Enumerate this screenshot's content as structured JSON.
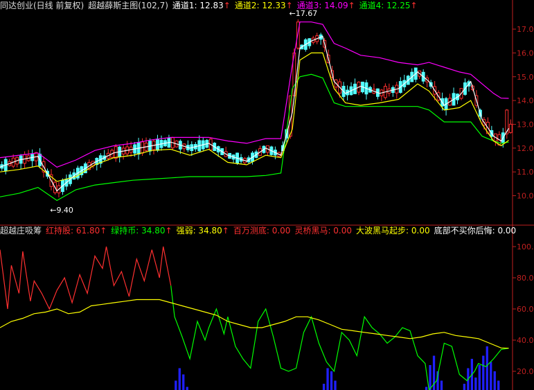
{
  "top_header": {
    "title": "同达创业(日线 前复权)",
    "indicator": "超越薛斯主图(102,7)",
    "items": [
      {
        "label": "通道1: 12.83",
        "arrow": "↑",
        "color": "#ffffff"
      },
      {
        "label": "通道2: 12.33",
        "arrow": "↑",
        "color": "#ffff00"
      },
      {
        "label": "通道3: 14.09",
        "arrow": "↑",
        "color": "#ff00ff"
      },
      {
        "label": "通道4: 12.25",
        "arrow": "↑",
        "color": "#00ff00"
      }
    ]
  },
  "bottom_header": {
    "title": "超越庄吸筹",
    "items": [
      {
        "label": "红持股: 61.80",
        "arrow": "↑",
        "color": "#ff3030"
      },
      {
        "label": "绿持币: 34.80",
        "arrow": "↑",
        "color": "#00ff00"
      },
      {
        "label": "强弱: 34.80",
        "arrow": "↑",
        "color": "#ffff00"
      },
      {
        "label": "百万测底: 0.00",
        "arrow": "",
        "color": "#ff3030"
      },
      {
        "label": "灵桥黑马: 0.00",
        "arrow": "",
        "color": "#ff3030"
      },
      {
        "label": "大波黑马起步: 0.00",
        "arrow": "",
        "color": "#ffff00"
      },
      {
        "label": "底部不买你后悔: 0.00",
        "arrow": "",
        "color": "#ffffff"
      }
    ]
  },
  "colors": {
    "up": "#ff3030",
    "down": "#54ffff",
    "ch1": "#ffffff",
    "ch2": "#ffff00",
    "ch3": "#ff00ff",
    "ch4": "#00ff00",
    "blue": "#2020ff",
    "axis": "#c02020"
  },
  "chart_data": [
    {
      "type": "candlestick",
      "annotations": [
        {
          "text": "9.40",
          "x": 15,
          "y": 9.4,
          "prefix": "←"
        },
        {
          "text": "17.67",
          "x": 78,
          "y": 17.67,
          "prefix": "←"
        }
      ],
      "xlim": [
        0,
        135
      ],
      "ylim": [
        9.2,
        17.7
      ],
      "yticks": [
        "10.0",
        "11.0",
        "12.0",
        "13.0",
        "14.0",
        "15.0",
        "16.0",
        "17.0"
      ],
      "channel1": [
        [
          0,
          11.2
        ],
        [
          5,
          11.5
        ],
        [
          10,
          11.65
        ],
        [
          15,
          10.2
        ],
        [
          20,
          10.9
        ],
        [
          25,
          11.4
        ],
        [
          30,
          11.8
        ],
        [
          35,
          11.95
        ],
        [
          40,
          12.1
        ],
        [
          45,
          12.25
        ],
        [
          50,
          12.0
        ],
        [
          55,
          12.2
        ],
        [
          60,
          11.7
        ],
        [
          65,
          11.45
        ],
        [
          70,
          12.0
        ],
        [
          74,
          11.7
        ],
        [
          77,
          13.5
        ],
        [
          79,
          16.2
        ],
        [
          82,
          16.5
        ],
        [
          85,
          16.7
        ],
        [
          88,
          14.8
        ],
        [
          91,
          14.3
        ],
        [
          95,
          14.6
        ],
        [
          100,
          14.3
        ],
        [
          105,
          14.5
        ],
        [
          110,
          15.2
        ],
        [
          113,
          14.8
        ],
        [
          117,
          13.8
        ],
        [
          121,
          14.2
        ],
        [
          124,
          14.8
        ],
        [
          127,
          13.2
        ],
        [
          130,
          12.5
        ],
        [
          132,
          12.3
        ],
        [
          134,
          12.83
        ]
      ],
      "channel2": [
        [
          0,
          11.0
        ],
        [
          5,
          11.1
        ],
        [
          10,
          11.25
        ],
        [
          15,
          10.6
        ],
        [
          20,
          10.8
        ],
        [
          25,
          11.3
        ],
        [
          30,
          11.6
        ],
        [
          35,
          11.7
        ],
        [
          40,
          11.9
        ],
        [
          45,
          11.95
        ],
        [
          50,
          11.7
        ],
        [
          55,
          11.95
        ],
        [
          60,
          11.4
        ],
        [
          65,
          11.3
        ],
        [
          70,
          11.7
        ],
        [
          74,
          11.6
        ],
        [
          77,
          12.8
        ],
        [
          79,
          15.7
        ],
        [
          82,
          16.0
        ],
        [
          85,
          16.0
        ],
        [
          88,
          14.5
        ],
        [
          91,
          13.9
        ],
        [
          95,
          13.8
        ],
        [
          100,
          13.9
        ],
        [
          105,
          14.05
        ],
        [
          110,
          14.7
        ],
        [
          113,
          14.4
        ],
        [
          117,
          13.6
        ],
        [
          121,
          13.7
        ],
        [
          124,
          14.0
        ],
        [
          127,
          13.0
        ],
        [
          130,
          12.3
        ],
        [
          132,
          12.1
        ],
        [
          134,
          12.33
        ]
      ],
      "channel3": [
        [
          0,
          11.6
        ],
        [
          5,
          11.7
        ],
        [
          10,
          11.8
        ],
        [
          15,
          11.2
        ],
        [
          20,
          11.5
        ],
        [
          25,
          11.9
        ],
        [
          30,
          12.1
        ],
        [
          35,
          12.2
        ],
        [
          40,
          12.35
        ],
        [
          45,
          12.45
        ],
        [
          50,
          12.45
        ],
        [
          55,
          12.45
        ],
        [
          60,
          12.3
        ],
        [
          65,
          12.2
        ],
        [
          70,
          12.4
        ],
        [
          74,
          12.4
        ],
        [
          77,
          15.5
        ],
        [
          79,
          17.3
        ],
        [
          82,
          17.3
        ],
        [
          85,
          17.2
        ],
        [
          88,
          16.4
        ],
        [
          91,
          16.2
        ],
        [
          95,
          15.9
        ],
        [
          100,
          15.8
        ],
        [
          105,
          15.6
        ],
        [
          110,
          15.5
        ],
        [
          113,
          15.6
        ],
        [
          117,
          15.4
        ],
        [
          121,
          15.2
        ],
        [
          124,
          15.1
        ],
        [
          127,
          14.7
        ],
        [
          130,
          14.3
        ],
        [
          132,
          14.1
        ],
        [
          134,
          14.09
        ]
      ],
      "channel4": [
        [
          0,
          9.95
        ],
        [
          5,
          10.1
        ],
        [
          10,
          10.35
        ],
        [
          15,
          9.8
        ],
        [
          20,
          10.25
        ],
        [
          25,
          10.45
        ],
        [
          30,
          10.55
        ],
        [
          35,
          10.65
        ],
        [
          40,
          10.7
        ],
        [
          45,
          10.75
        ],
        [
          50,
          10.8
        ],
        [
          55,
          10.8
        ],
        [
          60,
          10.8
        ],
        [
          65,
          10.8
        ],
        [
          70,
          10.85
        ],
        [
          74,
          10.95
        ],
        [
          77,
          14.5
        ],
        [
          79,
          15.0
        ],
        [
          82,
          15.1
        ],
        [
          85,
          14.95
        ],
        [
          88,
          13.9
        ],
        [
          91,
          13.75
        ],
        [
          95,
          13.75
        ],
        [
          100,
          13.75
        ],
        [
          105,
          13.75
        ],
        [
          110,
          13.75
        ],
        [
          113,
          13.6
        ],
        [
          117,
          13.1
        ],
        [
          121,
          13.1
        ],
        [
          124,
          13.1
        ],
        [
          127,
          12.5
        ],
        [
          130,
          12.3
        ],
        [
          132,
          12.2
        ],
        [
          134,
          12.25
        ]
      ]
    },
    {
      "type": "line",
      "xlim": [
        0,
        135
      ],
      "ylim": [
        8,
        108
      ],
      "yticks": [
        "20.0",
        "40.0",
        "60.0",
        "80.0",
        "100.0"
      ],
      "series": [
        {
          "name": "红持股",
          "points": [
            [
              0,
              98
            ],
            [
              2,
              60
            ],
            [
              3,
              88
            ],
            [
              5,
              70
            ],
            [
              6,
              97
            ],
            [
              8,
              65
            ],
            [
              9,
              78
            ],
            [
              11,
              70
            ],
            [
              13,
              60
            ],
            [
              15,
              72
            ],
            [
              17,
              80
            ],
            [
              19,
              64
            ],
            [
              21,
              82
            ],
            [
              23,
              70
            ],
            [
              25,
              94
            ],
            [
              27,
              86
            ],
            [
              28,
              100
            ],
            [
              30,
              75
            ],
            [
              32,
              84
            ],
            [
              34,
              68
            ],
            [
              36,
              92
            ],
            [
              38,
              78
            ],
            [
              40,
              98
            ],
            [
              42,
              80
            ],
            [
              43,
              100
            ],
            [
              45,
              75
            ]
          ]
        },
        {
          "name": "绿持币",
          "points": [
            [
              45,
              75
            ],
            [
              46,
              55
            ],
            [
              48,
              42
            ],
            [
              50,
              28
            ],
            [
              52,
              52
            ],
            [
              54,
              40
            ],
            [
              55,
              48
            ],
            [
              57,
              60
            ],
            [
              59,
              44
            ],
            [
              60,
              55
            ],
            [
              62,
              36
            ],
            [
              64,
              28
            ],
            [
              66,
              22
            ],
            [
              68,
              52
            ],
            [
              70,
              60
            ],
            [
              72,
              42
            ],
            [
              74,
              22
            ],
            [
              76,
              20
            ],
            [
              78,
              22
            ],
            [
              80,
              45
            ],
            [
              82,
              55
            ],
            [
              84,
              38
            ],
            [
              86,
              26
            ],
            [
              88,
              20
            ],
            [
              90,
              45
            ],
            [
              92,
              40
            ],
            [
              94,
              30
            ],
            [
              96,
              55
            ],
            [
              98,
              48
            ],
            [
              100,
              44
            ],
            [
              102,
              38
            ],
            [
              104,
              42
            ],
            [
              106,
              48
            ],
            [
              108,
              46
            ],
            [
              110,
              30
            ],
            [
              112,
              25
            ],
            [
              113,
              8
            ],
            [
              115,
              14
            ],
            [
              117,
              38
            ],
            [
              119,
              36
            ],
            [
              121,
              18
            ],
            [
              123,
              14
            ],
            [
              125,
              20
            ],
            [
              126,
              25
            ],
            [
              128,
              23
            ],
            [
              130,
              28
            ],
            [
              132,
              34
            ],
            [
              134,
              34.8
            ]
          ]
        },
        {
          "name": "强弱",
          "points": [
            [
              0,
              48
            ],
            [
              3,
              52
            ],
            [
              6,
              54
            ],
            [
              9,
              57
            ],
            [
              12,
              58
            ],
            [
              15,
              60
            ],
            [
              18,
              57
            ],
            [
              21,
              58
            ],
            [
              24,
              62
            ],
            [
              27,
              63
            ],
            [
              30,
              64
            ],
            [
              33,
              65
            ],
            [
              36,
              66
            ],
            [
              39,
              66
            ],
            [
              42,
              66
            ],
            [
              45,
              64
            ],
            [
              48,
              62
            ],
            [
              51,
              60
            ],
            [
              54,
              58
            ],
            [
              57,
              56
            ],
            [
              60,
              52
            ],
            [
              63,
              50
            ],
            [
              66,
              48
            ],
            [
              69,
              48
            ],
            [
              72,
              50
            ],
            [
              75,
              52
            ],
            [
              78,
              55
            ],
            [
              81,
              55
            ],
            [
              84,
              53
            ],
            [
              87,
              50
            ],
            [
              90,
              47
            ],
            [
              93,
              46
            ],
            [
              96,
              45
            ],
            [
              99,
              44
            ],
            [
              102,
              43
            ],
            [
              105,
              42
            ],
            [
              108,
              41
            ],
            [
              111,
              42
            ],
            [
              114,
              44
            ],
            [
              117,
              45
            ],
            [
              120,
              43
            ],
            [
              123,
              42
            ],
            [
              126,
              41
            ],
            [
              129,
              38
            ],
            [
              132,
              35
            ],
            [
              134,
              34.8
            ]
          ]
        }
      ],
      "bars_blue": [
        [
          46,
          14
        ],
        [
          47,
          22
        ],
        [
          48,
          18
        ],
        [
          49,
          10
        ],
        [
          85,
          12
        ],
        [
          86,
          22
        ],
        [
          87,
          20
        ],
        [
          88,
          14
        ],
        [
          112,
          10
        ],
        [
          113,
          24
        ],
        [
          114,
          30
        ],
        [
          115,
          20
        ],
        [
          116,
          14
        ],
        [
          117,
          8
        ],
        [
          122,
          12
        ],
        [
          123,
          22
        ],
        [
          124,
          28
        ],
        [
          125,
          16
        ],
        [
          126,
          24
        ],
        [
          127,
          30
        ],
        [
          128,
          36
        ],
        [
          129,
          26
        ],
        [
          130,
          20
        ],
        [
          131,
          14
        ],
        [
          132,
          8
        ]
      ]
    }
  ]
}
